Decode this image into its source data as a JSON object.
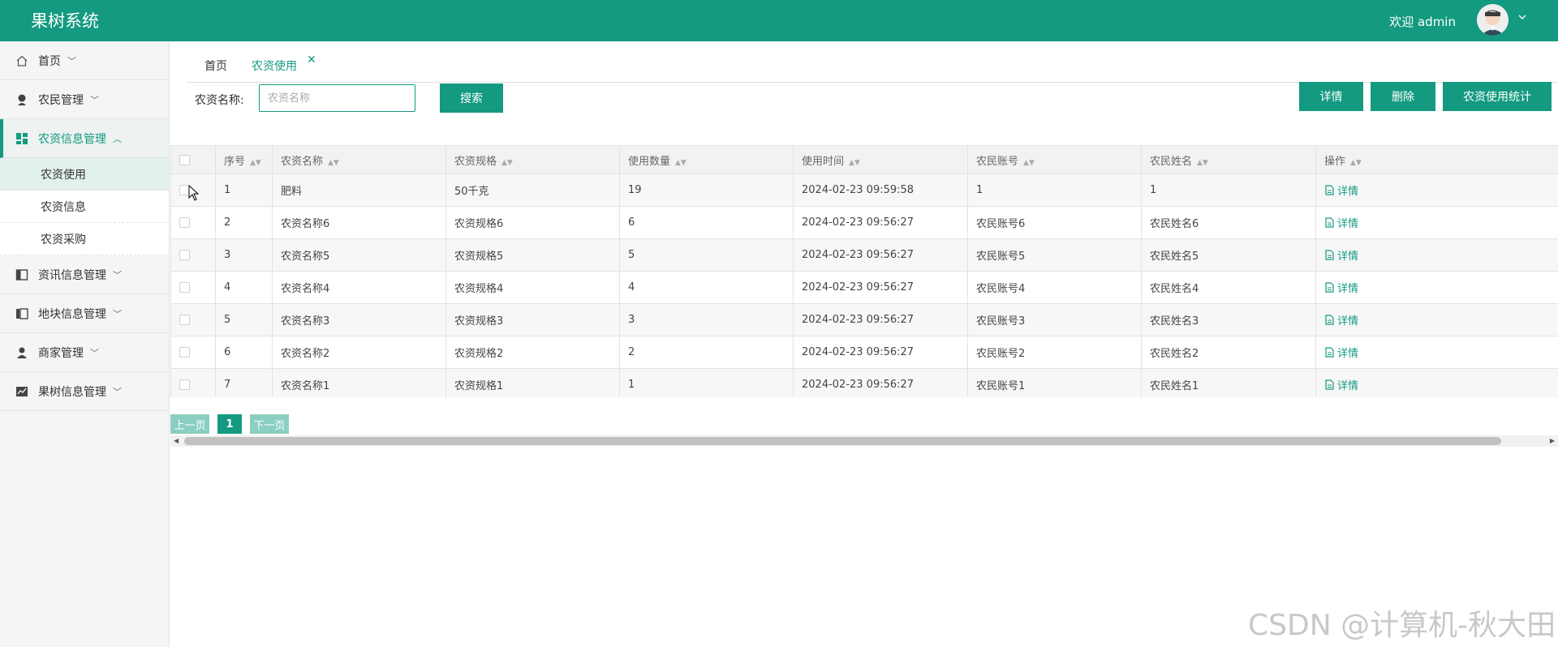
{
  "header": {
    "title": "果树系统",
    "welcome": "欢迎 admin",
    "avatar_icon": "user-avatar",
    "chevron_icon": "chevron-down-icon",
    "bg_color": "#139a80"
  },
  "sidebar": {
    "items": [
      {
        "label": "首页",
        "icon": "home-icon"
      },
      {
        "label": "农民管理",
        "icon": "person-icon"
      },
      {
        "label": "农资信息管理",
        "icon": "dashboard-icon",
        "expanded": true
      },
      {
        "label": "资讯信息管理",
        "icon": "panel-icon"
      },
      {
        "label": "地块信息管理",
        "icon": "columns-icon"
      },
      {
        "label": "商家管理",
        "icon": "user-icon"
      },
      {
        "label": "果树信息管理",
        "icon": "chart-icon"
      }
    ],
    "submenu": [
      {
        "label": "农资使用",
        "active": true
      },
      {
        "label": "农资信息"
      },
      {
        "label": "农资采购"
      }
    ]
  },
  "tabs": {
    "home": "首页",
    "active": "农资使用"
  },
  "search": {
    "label": "农资名称:",
    "placeholder": "农资名称",
    "button": "搜索"
  },
  "actions": {
    "detail": "详情",
    "delete": "删除",
    "stats": "农资使用统计"
  },
  "table": {
    "headers": [
      "序号",
      "农资名称",
      "农资规格",
      "使用数量",
      "使用时间",
      "农民账号",
      "农民姓名",
      "操作"
    ],
    "op_label": "详情",
    "rows": [
      [
        "1",
        "肥料",
        "50千克",
        "19",
        "2024-02-23 09:59:58",
        "1",
        "1"
      ],
      [
        "2",
        "农资名称6",
        "农资规格6",
        "6",
        "2024-02-23 09:56:27",
        "农民账号6",
        "农民姓名6"
      ],
      [
        "3",
        "农资名称5",
        "农资规格5",
        "5",
        "2024-02-23 09:56:27",
        "农民账号5",
        "农民姓名5"
      ],
      [
        "4",
        "农资名称4",
        "农资规格4",
        "4",
        "2024-02-23 09:56:27",
        "农民账号4",
        "农民姓名4"
      ],
      [
        "5",
        "农资名称3",
        "农资规格3",
        "3",
        "2024-02-23 09:56:27",
        "农民账号3",
        "农民姓名3"
      ],
      [
        "6",
        "农资名称2",
        "农资规格2",
        "2",
        "2024-02-23 09:56:27",
        "农民账号2",
        "农民姓名2"
      ],
      [
        "7",
        "农资名称1",
        "农资规格1",
        "1",
        "2024-02-23 09:56:27",
        "农民账号1",
        "农民姓名1"
      ]
    ]
  },
  "pager": {
    "prev": "上一页",
    "current": "1",
    "next": "下一页"
  },
  "watermark": "CSDN @计算机-秋大田"
}
